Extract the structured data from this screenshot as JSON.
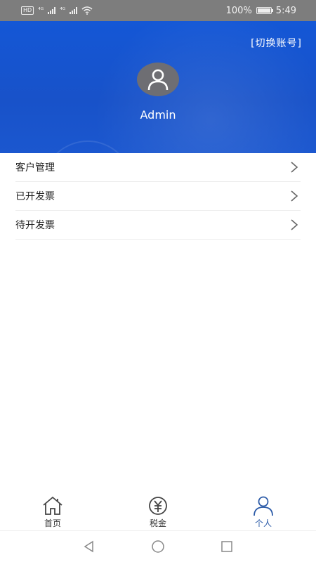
{
  "status_bar": {
    "left_badge": "HD",
    "signal1_label": "⁴ᴳ",
    "signal2_label": "⁴ᴳ",
    "battery_text": "100%",
    "time": "5:49"
  },
  "header": {
    "switch_account_label": "[切换账号]",
    "username": "Admin",
    "colors": {
      "background": "#1852c9",
      "avatar": "#6e6e73"
    }
  },
  "menu": {
    "items": [
      {
        "label": "客户管理"
      },
      {
        "label": "已开发票"
      },
      {
        "label": "待开发票"
      }
    ]
  },
  "tabbar": {
    "tabs": [
      {
        "label": "首页",
        "icon": "home-icon"
      },
      {
        "label": "税金",
        "icon": "yuan-icon"
      },
      {
        "label": "个人",
        "icon": "person-icon",
        "active": true
      }
    ],
    "colors": {
      "active": "#2c5ba8",
      "inactive": "#333333"
    }
  },
  "navbar": {
    "icons": [
      "back-icon",
      "home-circle-icon",
      "recents-icon"
    ]
  }
}
